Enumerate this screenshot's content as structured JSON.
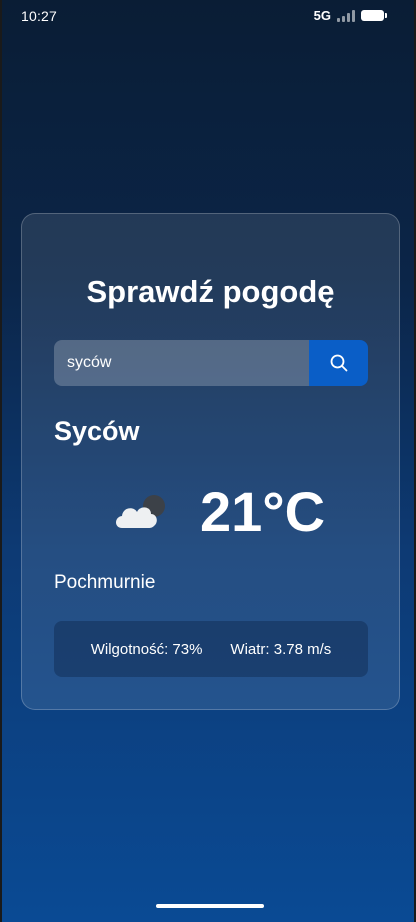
{
  "status_bar": {
    "time": "10:27",
    "network": "5G",
    "signal_bars_active": 0,
    "battery_level": 1.0
  },
  "card": {
    "title": "Sprawdź pogodę",
    "search": {
      "value": "syców",
      "button_icon": "search-icon"
    },
    "city": "Syców",
    "weather_icon": "cloudy-icon",
    "temperature": "21°C",
    "description": "Pochmurnie",
    "details": {
      "humidity": "Wilgotność: 73%",
      "wind": "Wiatr: 3.78 m/s"
    }
  },
  "colors": {
    "background_top": "#0a1d35",
    "background_bottom": "#0a4a94",
    "accent": "#0a5ec7",
    "text": "#ffffff"
  }
}
